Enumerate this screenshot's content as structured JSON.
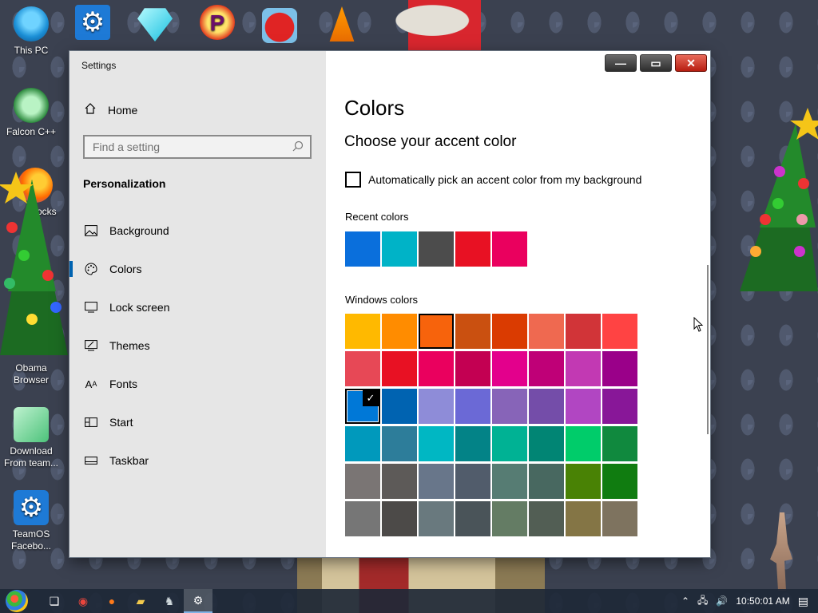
{
  "desktop": {
    "icons": [
      {
        "label": "This PC"
      },
      {
        "label": "Falcon C++"
      },
      {
        "label": "Cocks"
      },
      {
        "label": "Obama Browser"
      },
      {
        "label": "Download From team..."
      },
      {
        "label": "TeamOS Facebo..."
      }
    ]
  },
  "window": {
    "title": "Settings",
    "min_symbol": "—",
    "max_symbol": "▭",
    "close_symbol": "✕"
  },
  "sidebar": {
    "home_label": "Home",
    "search_placeholder": "Find a setting",
    "section_title": "Personalization",
    "items": [
      {
        "label": "Background",
        "icon": "image-icon"
      },
      {
        "label": "Colors",
        "icon": "palette-icon"
      },
      {
        "label": "Lock screen",
        "icon": "lock-screen-icon"
      },
      {
        "label": "Themes",
        "icon": "themes-icon"
      },
      {
        "label": "Fonts",
        "icon": "fonts-icon"
      },
      {
        "label": "Start",
        "icon": "start-icon"
      },
      {
        "label": "Taskbar",
        "icon": "taskbar-icon"
      }
    ],
    "active_item": "Colors"
  },
  "main": {
    "title": "Colors",
    "subtitle": "Choose your accent color",
    "auto_pick_label": "Automatically pick an accent color from my background",
    "auto_pick_checked": false,
    "recent_label": "Recent colors",
    "recent_colors": [
      "#0a6fdc",
      "#00b3c7",
      "#4c4c4c",
      "#e81123",
      "#ea005e"
    ],
    "windows_label": "Windows colors",
    "windows_colors": [
      "#ffb900",
      "#ff8c00",
      "#f7630c",
      "#ca5010",
      "#da3b01",
      "#ef6950",
      "#d13438",
      "#ff4343",
      "#e74856",
      "#e81123",
      "#ea005e",
      "#c30052",
      "#e3008c",
      "#bf0077",
      "#c239b3",
      "#9a0089",
      "#0078d7",
      "#0063b1",
      "#8e8cd8",
      "#6b69d6",
      "#8764b8",
      "#744da9",
      "#b146c2",
      "#881798",
      "#0099bc",
      "#2d7d9a",
      "#00b7c3",
      "#038387",
      "#00b294",
      "#018574",
      "#00cc6a",
      "#10893e",
      "#7a7574",
      "#5d5a58",
      "#68768a",
      "#515c6b",
      "#567c73",
      "#486860",
      "#498205",
      "#107c10",
      "#767676",
      "#4c4a48",
      "#69797e",
      "#4a5459",
      "#647c64",
      "#525e54",
      "#847545",
      "#7e735f"
    ],
    "selected_color": "#0078d7",
    "hovered_color": "#f7630c"
  },
  "taskbar": {
    "apps": [
      "task-view-icon",
      "chrome-icon",
      "firefox-icon",
      "file-explorer-icon",
      "game-icon",
      "settings-icon"
    ],
    "active_app": "settings-icon",
    "clock": "10:50:01 AM"
  },
  "colors": {
    "accent": "#0063b1",
    "sidebar_bg": "#e6e6e6"
  }
}
